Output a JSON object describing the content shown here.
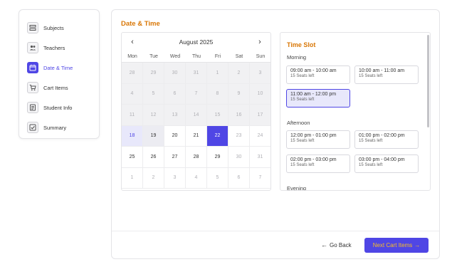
{
  "sidebar": {
    "items": [
      {
        "label": "Subjects",
        "icon": "list-icon"
      },
      {
        "label": "Teachers",
        "icon": "people-icon"
      },
      {
        "label": "Date & Time",
        "icon": "calendar-icon",
        "active": true
      },
      {
        "label": "Cart Items",
        "icon": "cart-icon"
      },
      {
        "label": "Student Info",
        "icon": "document-icon"
      },
      {
        "label": "Summary",
        "icon": "checkbox-icon"
      }
    ]
  },
  "main": {
    "section_title": "Date & Time",
    "calendar": {
      "month": "August 2025",
      "prev_symbol": "‹",
      "next_symbol": "›",
      "dows": [
        "Mon",
        "Tue",
        "Wed",
        "Thu",
        "Fri",
        "Sat",
        "Sun"
      ],
      "weeks": [
        [
          "28",
          "29",
          "30",
          "31",
          "1",
          "2",
          "3"
        ],
        [
          "4",
          "5",
          "6",
          "7",
          "8",
          "9",
          "10"
        ],
        [
          "11",
          "12",
          "13",
          "14",
          "15",
          "16",
          "17"
        ],
        [
          "18",
          "19",
          "20",
          "21",
          "22",
          "23",
          "24"
        ],
        [
          "25",
          "26",
          "27",
          "28",
          "29",
          "30",
          "31"
        ],
        [
          "1",
          "2",
          "3",
          "4",
          "5",
          "6",
          "7"
        ]
      ],
      "selected_day": "22"
    },
    "time_slot": {
      "title": "Time Slot",
      "groups": [
        {
          "label": "Morning",
          "slots": [
            {
              "time": "09:00 am - 10:00 am",
              "seats": "15 Seats left"
            },
            {
              "time": "10:00 am - 11:00 am",
              "seats": "15 Seats left"
            },
            {
              "time": "11:00 am - 12:00 pm",
              "seats": "15 Seats left",
              "selected": true
            }
          ]
        },
        {
          "label": "Afternoon",
          "slots": [
            {
              "time": "12:00 pm - 01:00 pm",
              "seats": "15 Seats left"
            },
            {
              "time": "01:00 pm - 02:00 pm",
              "seats": "15 Seats left"
            },
            {
              "time": "02:00 pm - 03:00 pm",
              "seats": "15 Seats left"
            },
            {
              "time": "03:00 pm - 04:00 pm",
              "seats": "15 Seats left"
            }
          ]
        },
        {
          "label": "Evening",
          "slots": []
        }
      ]
    },
    "footer": {
      "back_label": "Go Back",
      "back_arrow": "←",
      "next_label": "Next Cart Items",
      "next_arrow": "→"
    }
  },
  "colors": {
    "accent": "#4f46e5",
    "title": "#d97706",
    "next_text": "#fbbf24"
  }
}
